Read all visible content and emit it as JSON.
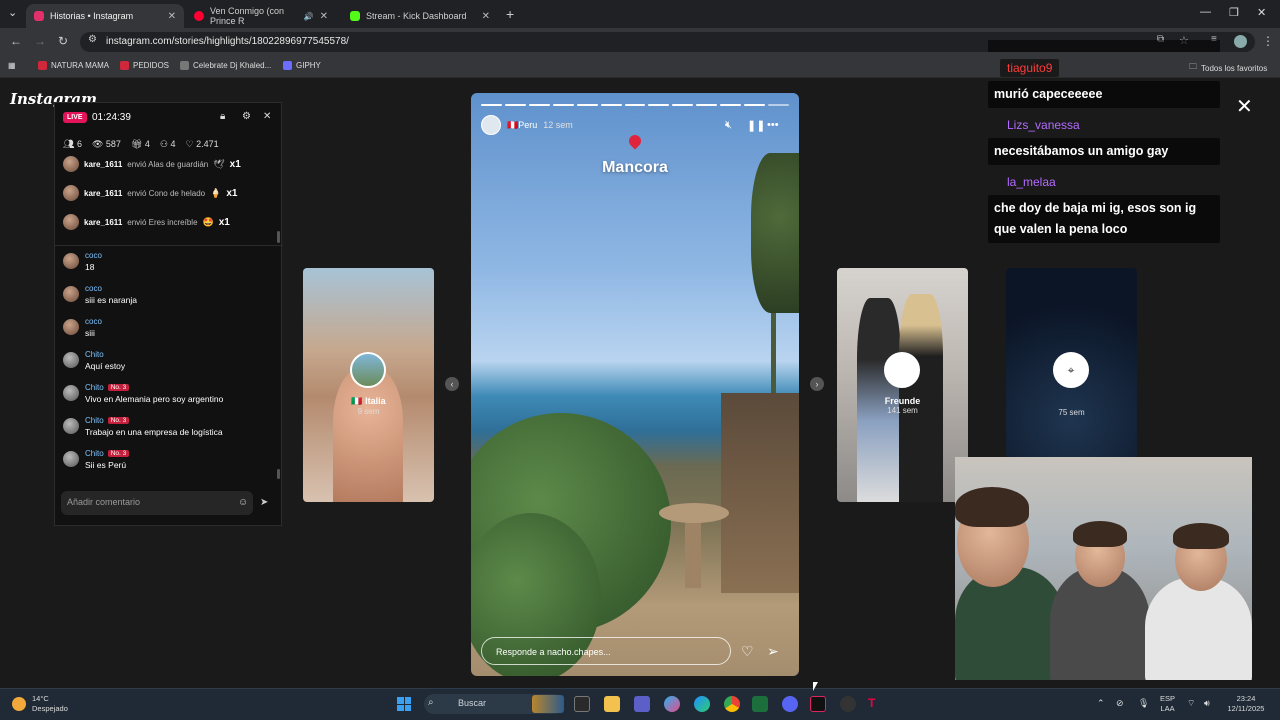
{
  "browser": {
    "tabs": [
      {
        "label": "Historias • Instagram",
        "color": "#e1306c"
      },
      {
        "label": "Ven Conmigo (con Prince R",
        "color": "#ff0033"
      },
      {
        "label": "Stream - Kick Dashboard",
        "color": "#53fc18"
      }
    ],
    "url": "instagram.com/stories/highlights/18022896977545578/",
    "bookmarks": [
      "NATURA MAMA",
      "PEDIDOS",
      "Celebrate Dj Khaled...",
      "GIPHY"
    ],
    "all_favorites": "Todos los favoritos"
  },
  "instagram": {
    "logo": "Instagram",
    "live": {
      "badge": "LIVE",
      "time": "01:24:39",
      "stats": {
        "a": "6",
        "viewers": "587",
        "gifts": "4",
        "b": "4",
        "likes": "2.471"
      },
      "gifts": [
        {
          "user": "kare_1611",
          "text": "envió Alas de guardián",
          "emoji": "🕊",
          "mult": "x1"
        },
        {
          "user": "kare_1611",
          "text": "envió Cono de helado",
          "emoji": "🍦",
          "mult": "x1"
        },
        {
          "user": "kare_1611",
          "text": "envió Eres increíble",
          "emoji": "🤩",
          "mult": "x1"
        }
      ],
      "comments": [
        {
          "user": "coco",
          "text": "18",
          "rank": ""
        },
        {
          "user": "coco",
          "text": "siii es naranja",
          "rank": ""
        },
        {
          "user": "coco",
          "text": "siii",
          "rank": ""
        },
        {
          "user": "Chito",
          "text": "Aquí estoy",
          "rank": ""
        },
        {
          "user": "Chito",
          "text": "Vivo en Alemania pero soy argentino",
          "rank": "No. 3"
        },
        {
          "user": "Chito",
          "text": "Trabajo en una empresa de logística",
          "rank": "No. 3"
        },
        {
          "user": "Chito",
          "text": "Sii es Perú",
          "rank": "No. 3"
        }
      ],
      "comment_placeholder": "Añadir comentario"
    },
    "left_card": {
      "title": "🇮🇹 Italia",
      "age": "9 sem"
    },
    "story": {
      "user": "🇵🇪Peru",
      "age": "12 sem",
      "location": "Mancora",
      "reply_placeholder": "Responde a nacho.chapes..."
    },
    "right_cards": [
      {
        "title": "Freunde",
        "age": "141 sem"
      },
      {
        "title": "",
        "age": "75 sem"
      }
    ]
  },
  "chat": [
    {
      "name": "tiaguito9",
      "name_color": "#ff3b3b",
      "text": "murió capeceeeee"
    },
    {
      "name": "Lizs_vanessa",
      "name_color": "#b36bff",
      "text": "necesitábamos un amigo gay"
    },
    {
      "name": "la_melaa",
      "name_color": "#b36bff",
      "text": "che doy de baja mi ig, esos son ig que valen la pena loco"
    }
  ],
  "taskbar": {
    "weather_temp": "14°C",
    "weather_desc": "Despejado",
    "search": "Buscar",
    "lang1": "ESP",
    "lang2": "LAA",
    "time": "23:24",
    "date": "12/11/2025"
  }
}
